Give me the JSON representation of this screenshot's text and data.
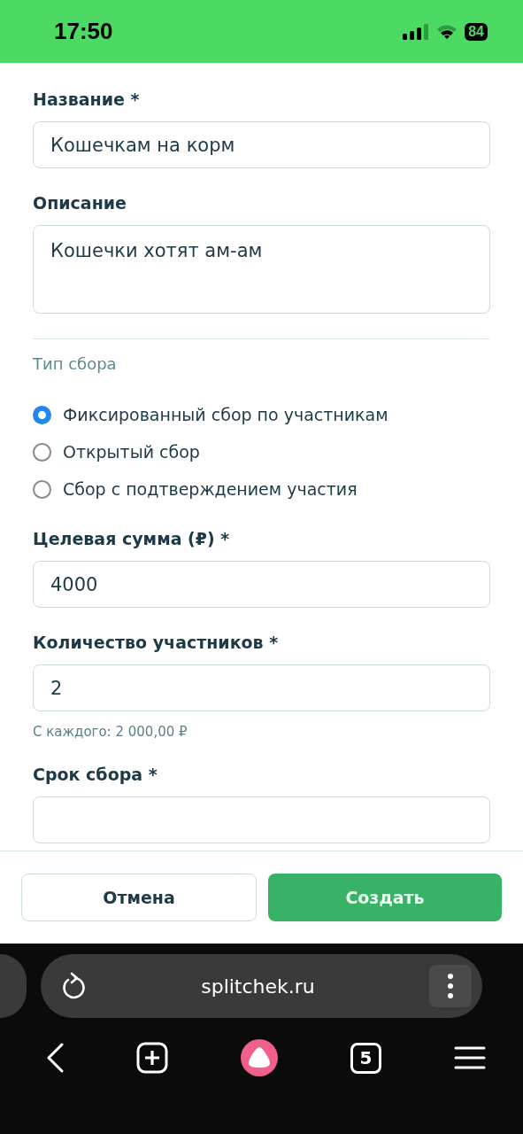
{
  "status_bar": {
    "time": "17:50",
    "battery": "84"
  },
  "form": {
    "fields": [
      {
        "kind": "input",
        "label": "Название *",
        "value": "Кошечкам на корм"
      },
      {
        "kind": "textarea",
        "label": "Описание",
        "value": "Кошечки хотят ам-ам"
      },
      {
        "kind": "radio_group",
        "label": "Тип сбора",
        "options": [
          {
            "label": "Фиксированный сбор по участникам",
            "selected": true
          },
          {
            "label": "Открытый сбор",
            "selected": false
          },
          {
            "label": "Сбор с подтверждением участия",
            "selected": false
          }
        ]
      },
      {
        "kind": "input",
        "label": "Целевая сумма (₽) *",
        "value": "4000"
      },
      {
        "kind": "input",
        "label": "Количество участников *",
        "value": "2",
        "hint": "С каждого: 2 000,00 ₽"
      },
      {
        "kind": "input",
        "label": "Срок сбора *"
      }
    ]
  },
  "actions": [
    {
      "kind": "secondary",
      "label": "Отмена"
    },
    {
      "kind": "primary",
      "label": "Создать"
    }
  ],
  "browser": {
    "url": "splitchek.ru",
    "tab_count": "5"
  }
}
